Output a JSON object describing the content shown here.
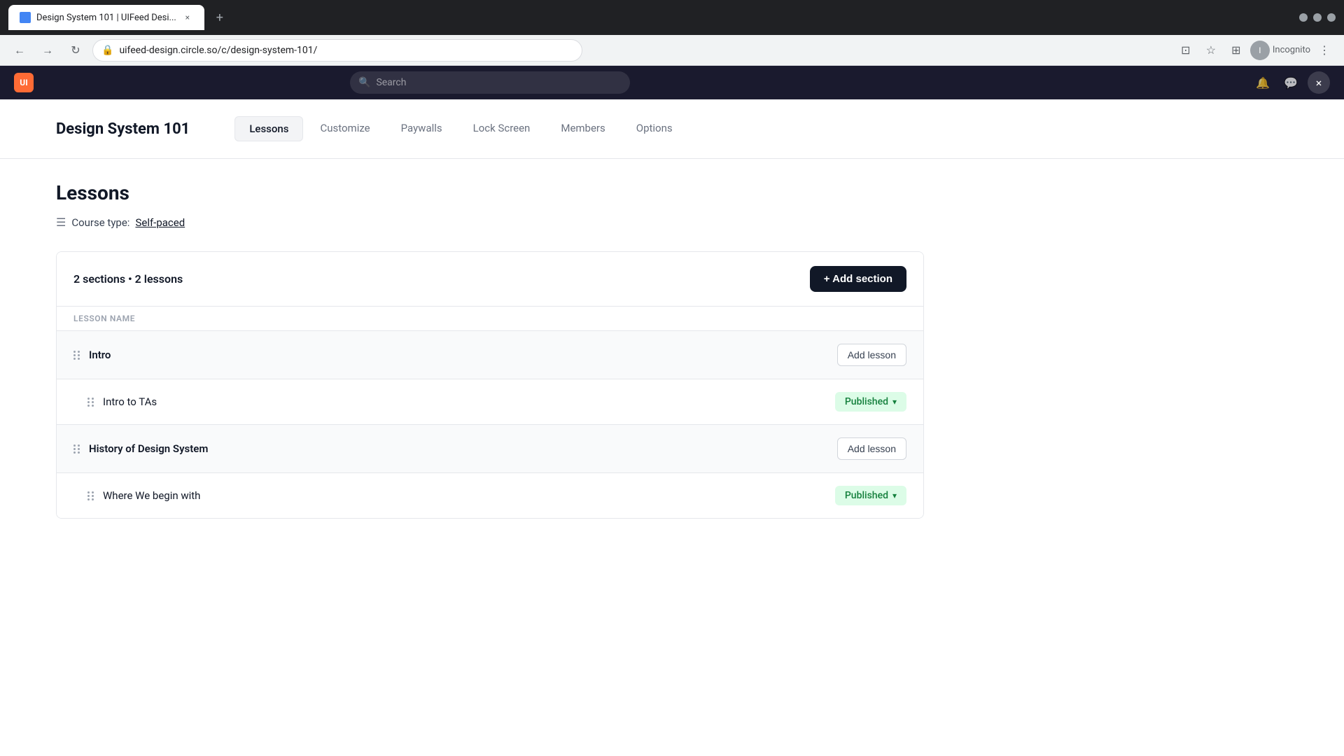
{
  "browser": {
    "tab": {
      "title": "Design System 101 | UIFeed Desi...",
      "close_label": "×"
    },
    "new_tab_label": "+",
    "address": "uifeed-design.circle.so/c/design-system-101/",
    "incognito_label": "Incognito",
    "nav": {
      "back_icon": "←",
      "forward_icon": "→",
      "reload_icon": "↻"
    }
  },
  "app_header": {
    "search_placeholder": "Search",
    "close_icon": "×"
  },
  "course": {
    "title": "Design System 101",
    "tabs": [
      {
        "id": "lessons",
        "label": "Lessons",
        "active": true
      },
      {
        "id": "customize",
        "label": "Customize",
        "active": false
      },
      {
        "id": "paywalls",
        "label": "Paywalls",
        "active": false
      },
      {
        "id": "lock-screen",
        "label": "Lock Screen",
        "active": false
      },
      {
        "id": "members",
        "label": "Members",
        "active": false
      },
      {
        "id": "options",
        "label": "Options",
        "active": false
      }
    ]
  },
  "lessons_page": {
    "title": "Lessons",
    "course_type_label": "Course type:",
    "course_type_value": "Self-paced",
    "sections_summary": "2 sections • 2 lessons",
    "add_section_label": "+ Add section",
    "column_header": "LESSON NAME",
    "sections": [
      {
        "id": "intro",
        "name": "Intro",
        "type": "section",
        "action_label": "Add lesson",
        "lessons": [
          {
            "id": "intro-to-tas",
            "name": "Intro to TAs",
            "status": "Published"
          }
        ]
      },
      {
        "id": "history",
        "name": "History of Design System",
        "type": "section",
        "action_label": "Add lesson",
        "lessons": [
          {
            "id": "where-we-begin",
            "name": "Where We begin with",
            "status": "Published"
          }
        ]
      }
    ]
  }
}
